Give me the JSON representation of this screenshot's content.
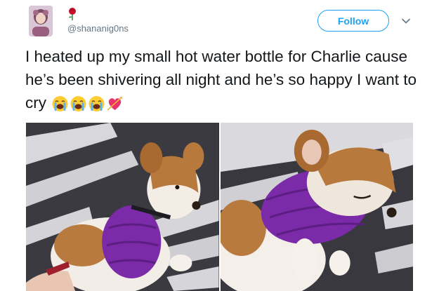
{
  "tweet": {
    "handle": "@shananig0ns",
    "follow_label": "Follow",
    "text": "I heated up my small hot water bottle for Charlie cause he’s been shivering all night and he’s so happy I want to cry",
    "emojis": [
      "loudly-crying-face",
      "loudly-crying-face",
      "loudly-crying-face",
      "heart-with-arrow"
    ]
  },
  "icons": {
    "avatar": "avatar-portrait",
    "name_badge": "rose-icon",
    "menu": "chevron-down-icon"
  },
  "colors": {
    "accent": "#1da1f2",
    "text": "#14171a",
    "muted": "#657786"
  },
  "photos": [
    {
      "subject": "dog-hugging-purple-hot-water-bottle"
    },
    {
      "subject": "dog-sleeping-on-purple-hot-water-bottle"
    }
  ]
}
